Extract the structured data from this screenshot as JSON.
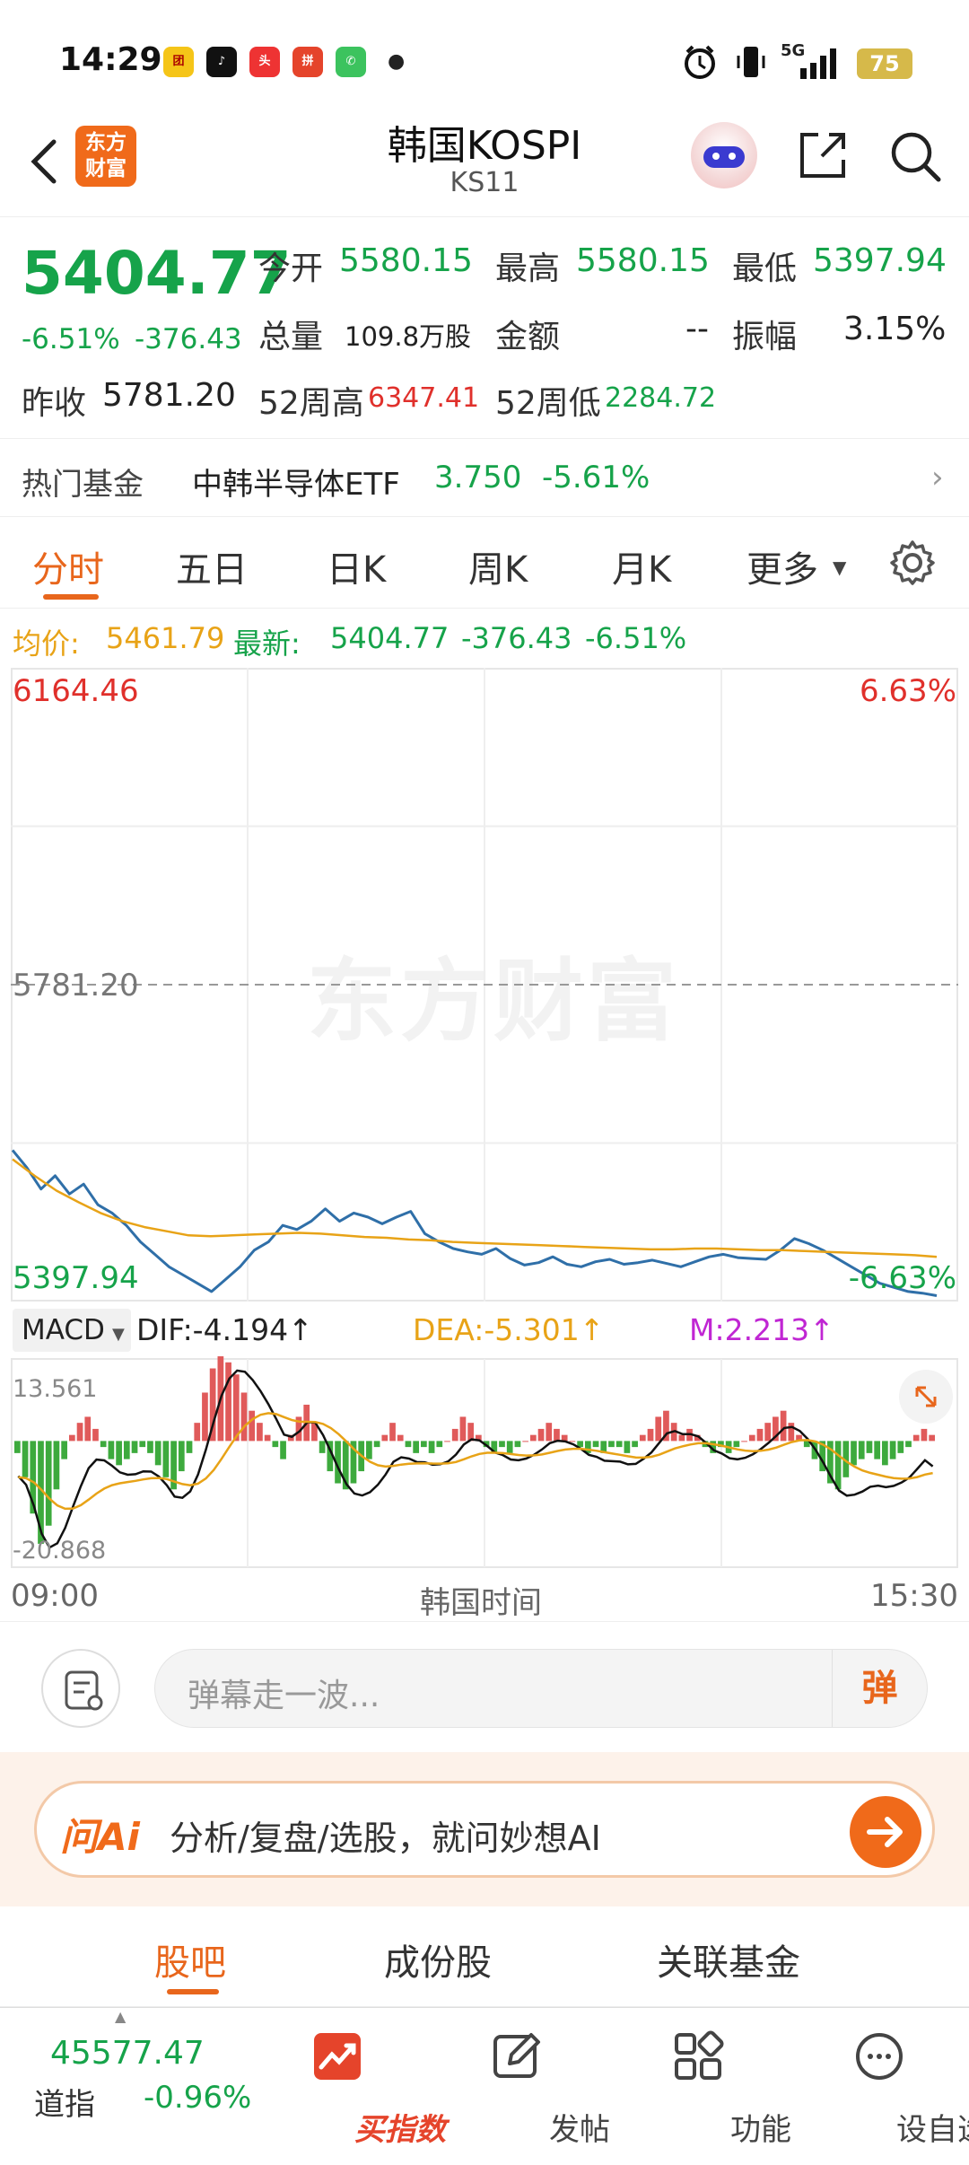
{
  "status_bar": {
    "time": "14:29",
    "apps": [
      "团购",
      "抖音",
      "头条",
      "拼多多",
      "电话"
    ],
    "battery": "75",
    "network": "5G"
  },
  "header": {
    "logo_text_1": "东方",
    "logo_text_2": "财富",
    "title": "韩国KOSPI",
    "subtitle": "KS11"
  },
  "quote": {
    "price": "5404.77",
    "change_pct": "-6.51%",
    "change": "-376.43",
    "open_label": "今开",
    "open": "5580.15",
    "high_label": "最高",
    "high": "5580.15",
    "low_label": "最低",
    "low": "5397.94",
    "volume_label": "总量",
    "volume": "109.8万股",
    "amount_label": "金额",
    "amount": "--",
    "amplitude_label": "振幅",
    "amplitude": "3.15%",
    "prev_close_label": "昨收",
    "prev_close": "5781.20",
    "wk52_high_label": "52周高",
    "wk52_high": "6347.41",
    "wk52_low_label": "52周低",
    "wk52_low": "2284.72"
  },
  "hot_fund": {
    "label": "热门基金",
    "name": "中韩半导体ETF",
    "price": "3.750",
    "change": "-5.61%"
  },
  "tabs": [
    "分时",
    "五日",
    "日K",
    "周K",
    "月K",
    "更多"
  ],
  "info_line": {
    "avg_label": "均价:",
    "avg": "5461.79",
    "latest_label": "最新:",
    "latest": "5404.77",
    "change": "-376.43",
    "pct": "-6.51%"
  },
  "chart_meta": {
    "top_value": "6164.46",
    "top_pct": "6.63%",
    "mid_value": "5781.20",
    "bottom_value": "5397.94",
    "bottom_pct": "-6.63%",
    "watermark": "东方财富",
    "macd_label": "MACD",
    "dif": "DIF:-4.194↑",
    "dea": "DEA:-5.301↑",
    "m": "M:2.213↑",
    "macd_top": "13.561",
    "macd_bottom": "-20.868",
    "x_start": "09:00",
    "x_mid": "韩国时间",
    "x_end": "15:30"
  },
  "chart_data": {
    "type": "line",
    "title": "",
    "xlabel": "韩国时间",
    "ylabel": "",
    "x_range": [
      "09:00",
      "15:30"
    ],
    "ylim": [
      5397.94,
      6164.46
    ],
    "reference_line": 5781.2,
    "series": [
      {
        "name": "",
        "color": "#2f6fa8",
        "values": [
          5581,
          5560,
          5534,
          5550,
          5528,
          5540,
          5515,
          5505,
          5490,
          5470,
          5455,
          5440,
          5430,
          5420,
          5410,
          5425,
          5440,
          5460,
          5470,
          5490,
          5485,
          5495,
          5510,
          5495,
          5505,
          5500,
          5492,
          5500,
          5507,
          5480,
          5470,
          5462,
          5458,
          5455,
          5462,
          5450,
          5442,
          5445,
          5452,
          5443,
          5440,
          5446,
          5449,
          5443,
          5445,
          5448,
          5444,
          5440,
          5446,
          5452,
          5455,
          5451,
          5450,
          5449,
          5460,
          5474,
          5468,
          5460,
          5450,
          5440,
          5430,
          5420,
          5415,
          5410,
          5408,
          5405
        ]
      },
      {
        "name": "",
        "color": "#e8a317",
        "values": [
          5570,
          5550,
          5532,
          5518,
          5505,
          5495,
          5488,
          5483,
          5478,
          5477,
          5478,
          5479,
          5480,
          5481,
          5480,
          5478,
          5476,
          5475,
          5473,
          5472,
          5470,
          5469,
          5468,
          5467,
          5466,
          5465,
          5464,
          5463,
          5462,
          5461,
          5461,
          5462,
          5462,
          5461,
          5460,
          5460,
          5459,
          5458,
          5457,
          5456,
          5455,
          5454,
          5452
        ]
      }
    ],
    "macd": {
      "ylim": [
        -20.868,
        13.561
      ],
      "dif": -4.194,
      "dea": -5.301,
      "m": 2.213,
      "histogram": [
        -2,
        -6,
        -12,
        -17,
        -14,
        -8,
        -3,
        1,
        3,
        4,
        2,
        -1,
        -3,
        -4,
        -3,
        -2,
        -1,
        -2,
        -4,
        -6,
        -8,
        -5,
        -2,
        3,
        8,
        12,
        14,
        13,
        11,
        8,
        5,
        3,
        1,
        -1,
        -3,
        1,
        4,
        6,
        3,
        -2,
        -5,
        -7,
        -8,
        -7,
        -5,
        -3,
        -1,
        1,
        3,
        1,
        -1,
        -2,
        -1,
        -2,
        -1,
        0,
        2,
        4,
        3,
        1,
        -1,
        -2,
        -1,
        -2,
        -1,
        0,
        1,
        2,
        3,
        2,
        1,
        0,
        -1,
        -2,
        -1,
        -2,
        -1,
        -1,
        -2,
        -1,
        1,
        2,
        4,
        5,
        3,
        1,
        2,
        1,
        -1,
        -2,
        -1,
        -2,
        -1,
        0,
        1,
        2,
        3,
        4,
        5,
        3,
        1,
        -1,
        -3,
        -5,
        -7,
        -8,
        -6,
        -4,
        -3,
        -2,
        -3,
        -4,
        -3,
        -2,
        -1,
        1,
        2,
        1
      ]
    }
  },
  "danmu": {
    "placeholder": "弹幕走一波...",
    "button": "弹"
  },
  "ask_ai": {
    "logo": "问Ai",
    "text": "分析/复盘/选股，就问妙想AI"
  },
  "sub_tabs": [
    "股吧",
    "成份股",
    "关联基金"
  ],
  "bottom_nav": {
    "index_value": "45577.47",
    "index_name": "道指",
    "index_change": "-0.96%",
    "items": [
      "买指数",
      "发帖",
      "功能",
      "设自选"
    ]
  }
}
